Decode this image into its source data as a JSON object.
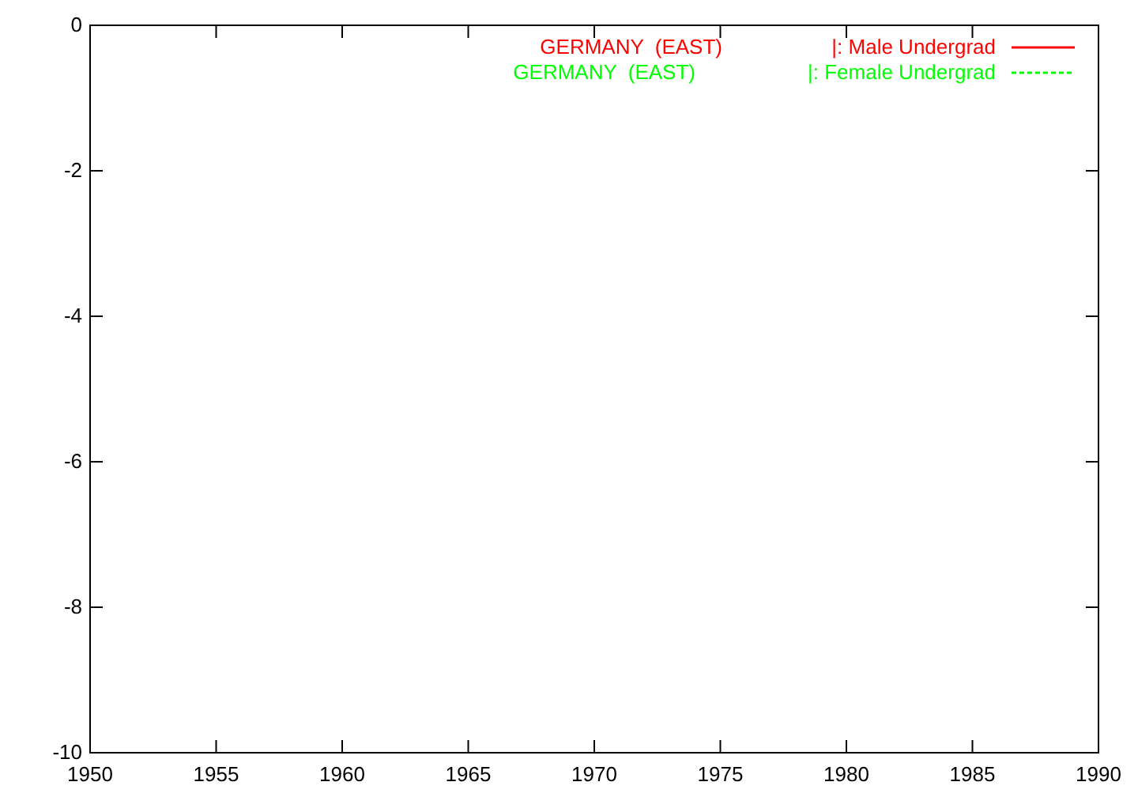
{
  "plot": {
    "y_ticks": [
      "0",
      "-2",
      "-4",
      "-6",
      "-8",
      "-10"
    ],
    "x_ticks": [
      "1950",
      "1955",
      "1960",
      "1965",
      "1970",
      "1975",
      "1980",
      "1985",
      "1990"
    ],
    "legend": [
      {
        "group": "GERMANY  (EAST)",
        "label": "|: Male Undergrad",
        "color": "#ff0000",
        "kind": "solid"
      },
      {
        "group": "GERMANY  (EAST)",
        "label": "|: Female Undergrad",
        "color": "#00ff00",
        "kind": "dashed"
      }
    ]
  }
}
